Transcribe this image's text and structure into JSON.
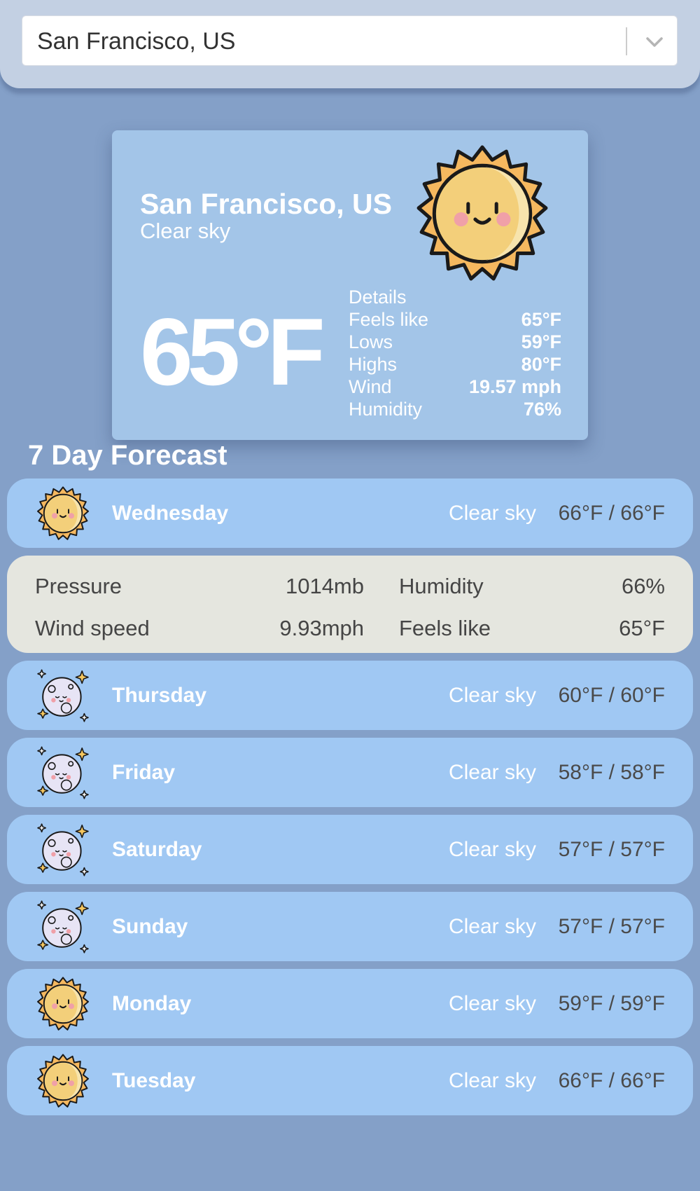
{
  "search": {
    "value": "San Francisco, US"
  },
  "current": {
    "city": "San Francisco, US",
    "condition": "Clear sky",
    "temperature": "65°F",
    "icon": "sun-icon",
    "details_title": "Details",
    "details": [
      {
        "label": "Feels like",
        "value": "65°F"
      },
      {
        "label": "Lows",
        "value": "59°F"
      },
      {
        "label": "Highs",
        "value": "80°F"
      },
      {
        "label": "Wind",
        "value": "19.57 mph"
      },
      {
        "label": "Humidity",
        "value": "76%"
      }
    ]
  },
  "forecast": {
    "title": "7 Day Forecast",
    "days": [
      {
        "day": "Wednesday",
        "desc": "Clear sky",
        "temp": "66°F / 66°F",
        "icon": "sun-icon"
      },
      {
        "day": "Thursday",
        "desc": "Clear sky",
        "temp": "60°F / 60°F",
        "icon": "moon-icon"
      },
      {
        "day": "Friday",
        "desc": "Clear sky",
        "temp": "58°F / 58°F",
        "icon": "moon-icon"
      },
      {
        "day": "Saturday",
        "desc": "Clear sky",
        "temp": "57°F / 57°F",
        "icon": "moon-icon"
      },
      {
        "day": "Sunday",
        "desc": "Clear sky",
        "temp": "57°F / 57°F",
        "icon": "moon-icon"
      },
      {
        "day": "Monday",
        "desc": "Clear sky",
        "temp": "59°F / 59°F",
        "icon": "sun-icon"
      },
      {
        "day": "Tuesday",
        "desc": "Clear sky",
        "temp": "66°F / 66°F",
        "icon": "sun-icon"
      }
    ],
    "expanded": {
      "pressure_label": "Pressure",
      "pressure_value": "1014mb",
      "humidity_label": "Humidity",
      "humidity_value": "66%",
      "wind_label": "Wind speed",
      "wind_value": "9.93mph",
      "feels_label": "Feels like",
      "feels_value": "65°F"
    }
  },
  "colors": {
    "background": "#84a0c8",
    "card": "#a3c5e8",
    "row": "#a0c8f3",
    "expanded": "#e5e6df"
  }
}
